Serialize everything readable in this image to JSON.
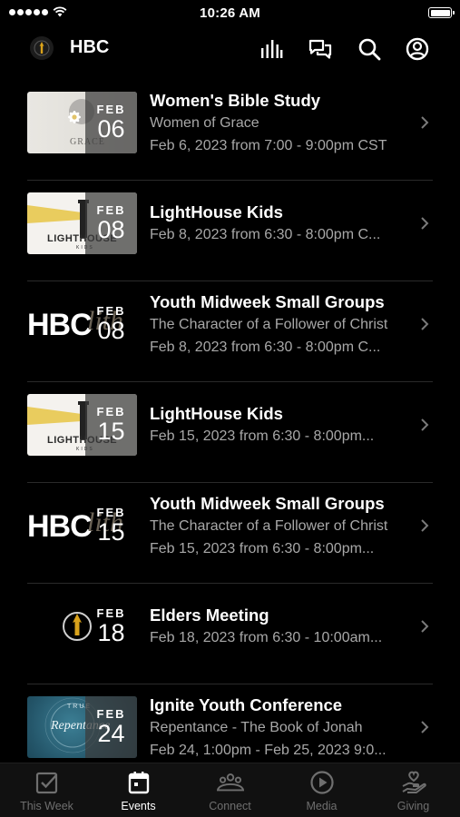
{
  "status_bar": {
    "time": "10:26 AM"
  },
  "header": {
    "title": "HBC"
  },
  "events": [
    {
      "month": "FEB",
      "day": "06",
      "title": "Women's Bible Study",
      "line1": "Women of Grace",
      "line2": "Feb 6, 2023 from 7:00 - 9:00pm CST",
      "art": "grace",
      "art_text": "GRACE"
    },
    {
      "month": "FEB",
      "day": "08",
      "title": "LightHouse Kids",
      "line1": "Feb 8, 2023 from 6:30 - 8:00pm C...",
      "line2": "",
      "art": "lighthouse",
      "art_text": "LIGHTHOUSE",
      "art_sub": "KIDS"
    },
    {
      "month": "FEB",
      "day": "08",
      "title": "Youth Midweek Small Groups",
      "line1": "The Character of a Follower of Christ",
      "line2": "Feb 8, 2023 from 6:30 - 8:00pm C...",
      "art": "hbc",
      "art_text": "HBC",
      "art_script": "lith"
    },
    {
      "month": "FEB",
      "day": "15",
      "title": "LightHouse Kids",
      "line1": "Feb 15, 2023 from 6:30 - 8:00pm...",
      "line2": "",
      "art": "lighthouse",
      "art_text": "LIGHTHOUSE",
      "art_sub": "KIDS"
    },
    {
      "month": "FEB",
      "day": "15",
      "title": "Youth Midweek Small Groups",
      "line1": "The Character of a Follower of Christ",
      "line2": "Feb 15, 2023 from 6:30 - 8:00pm...",
      "art": "hbc",
      "art_text": "HBC",
      "art_script": "lith"
    },
    {
      "month": "FEB",
      "day": "18",
      "title": "Elders Meeting",
      "line1": "Feb 18, 2023 from 6:30 - 10:00am...",
      "line2": "",
      "art": "elders"
    },
    {
      "month": "FEB",
      "day": "24",
      "title": "Ignite Youth Conference",
      "line1": "Repentance - The Book of Jonah",
      "line2": "Feb 24, 1:00pm - Feb 25, 2023 9:0...",
      "art": "ignite",
      "art_text": "Repentance",
      "art_top": "TRUE"
    }
  ],
  "tabs": [
    {
      "label": "This Week",
      "icon": "checkbox-icon"
    },
    {
      "label": "Events",
      "icon": "calendar-icon",
      "active": true
    },
    {
      "label": "Connect",
      "icon": "people-icon"
    },
    {
      "label": "Media",
      "icon": "play-icon"
    },
    {
      "label": "Giving",
      "icon": "giving-hand-icon"
    }
  ],
  "colors": {
    "background": "#000000",
    "accent": "#ffffff",
    "inactive": "#6f6f6f",
    "secondary_text": "#a8a8a8"
  }
}
